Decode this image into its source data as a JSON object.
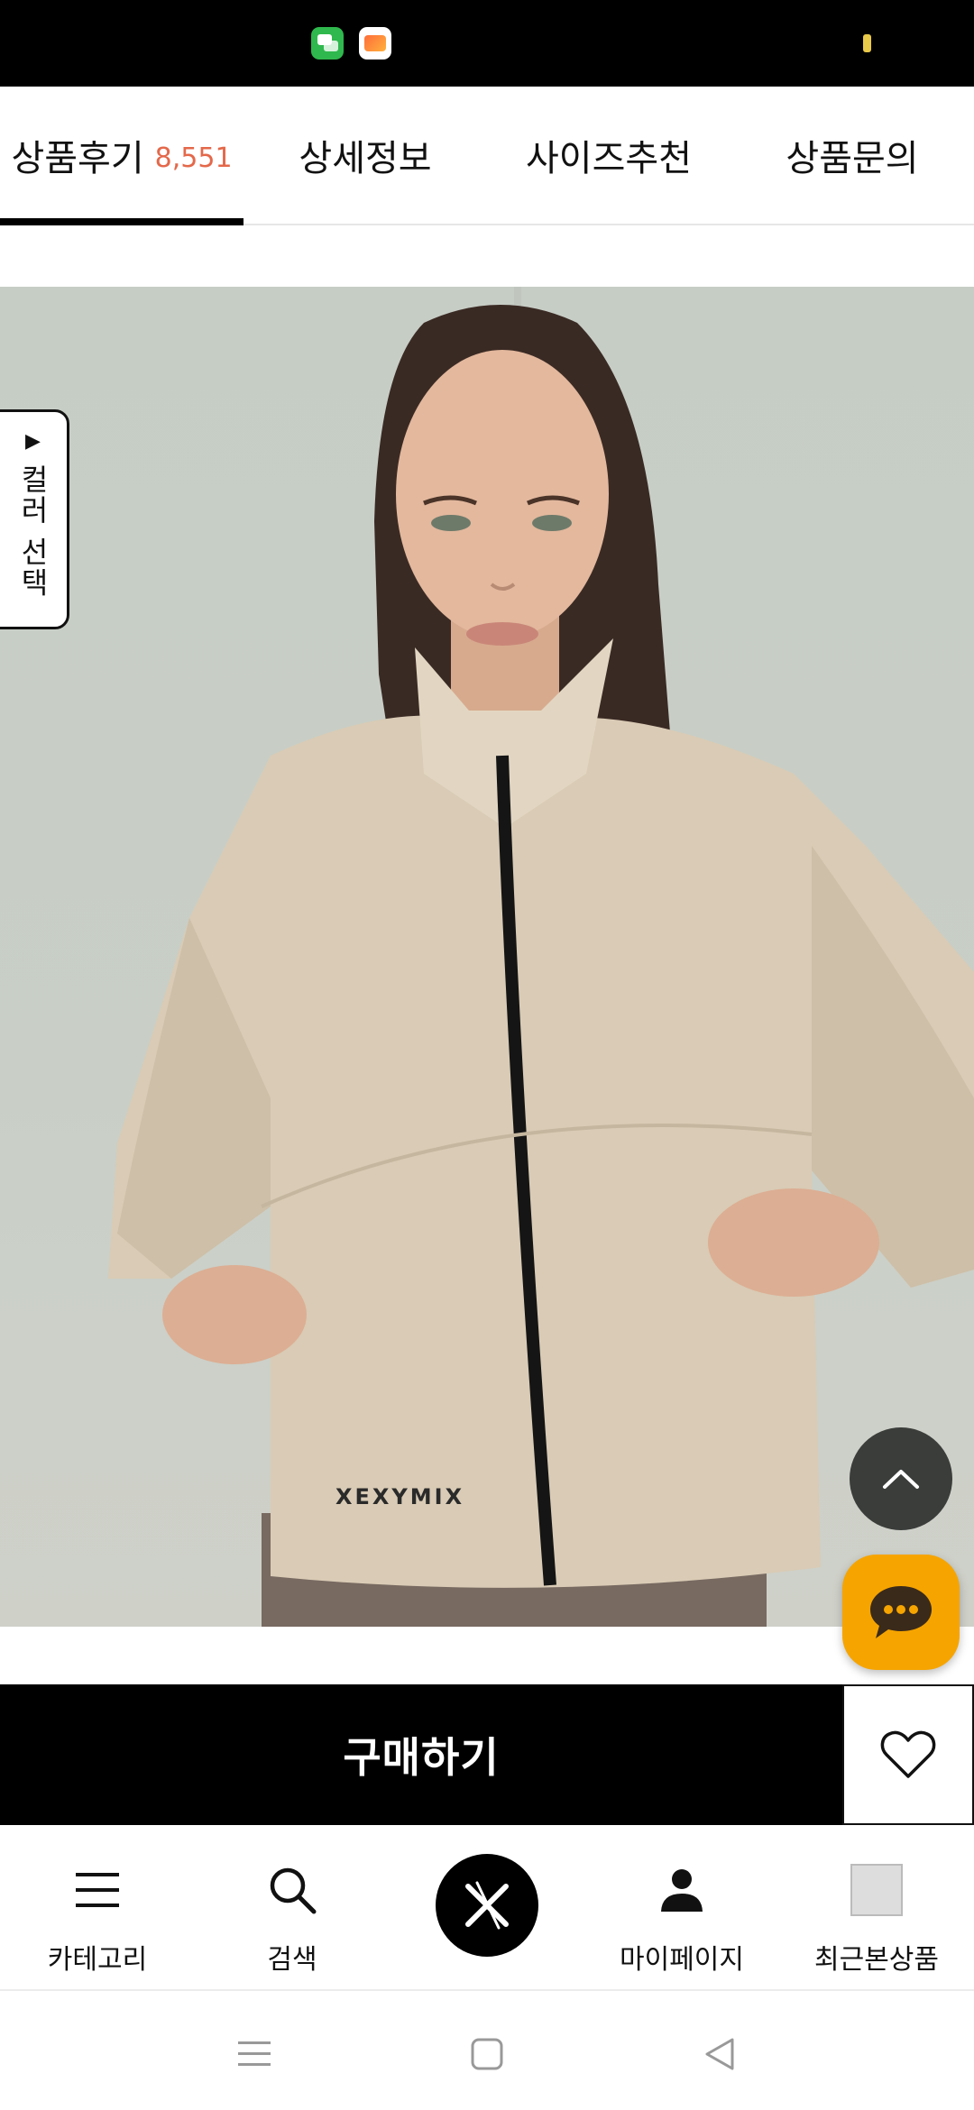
{
  "status_bar": {
    "icons": [
      "messages-app-icon",
      "gallery-app-icon",
      "battery-indicator"
    ],
    "colors": {
      "background": "#000000",
      "battery": "#e9c94a"
    }
  },
  "tabs": [
    {
      "label": "상품후기",
      "count": "8,551",
      "active": true
    },
    {
      "label": "상세정보"
    },
    {
      "label": "사이즈추천"
    },
    {
      "label": "상품문의"
    }
  ],
  "product": {
    "brand_mark": "XEXYMIX",
    "color_select_label": "컬러 선택",
    "color_select_arrow": "▶"
  },
  "floating": {
    "scroll_top_icon": "chevron-up-icon",
    "chat_icon": "chat-bubble-icon"
  },
  "purchase": {
    "buy_label": "구매하기",
    "wishlist_icon": "heart-icon"
  },
  "bottom_nav": [
    {
      "label": "카테고리",
      "icon": "menu-icon"
    },
    {
      "label": "검색",
      "icon": "search-icon"
    },
    {
      "label": "",
      "icon": "brand-logo-icon"
    },
    {
      "label": "마이페이지",
      "icon": "person-icon"
    },
    {
      "label": "최근본상품",
      "icon": "recent-product-thumbnail"
    }
  ],
  "colors": {
    "accent_count": "#e4684a",
    "buy_button": "#000000",
    "chat_button": "#f6a400",
    "scroll_top_button": "#3a3d3a"
  }
}
